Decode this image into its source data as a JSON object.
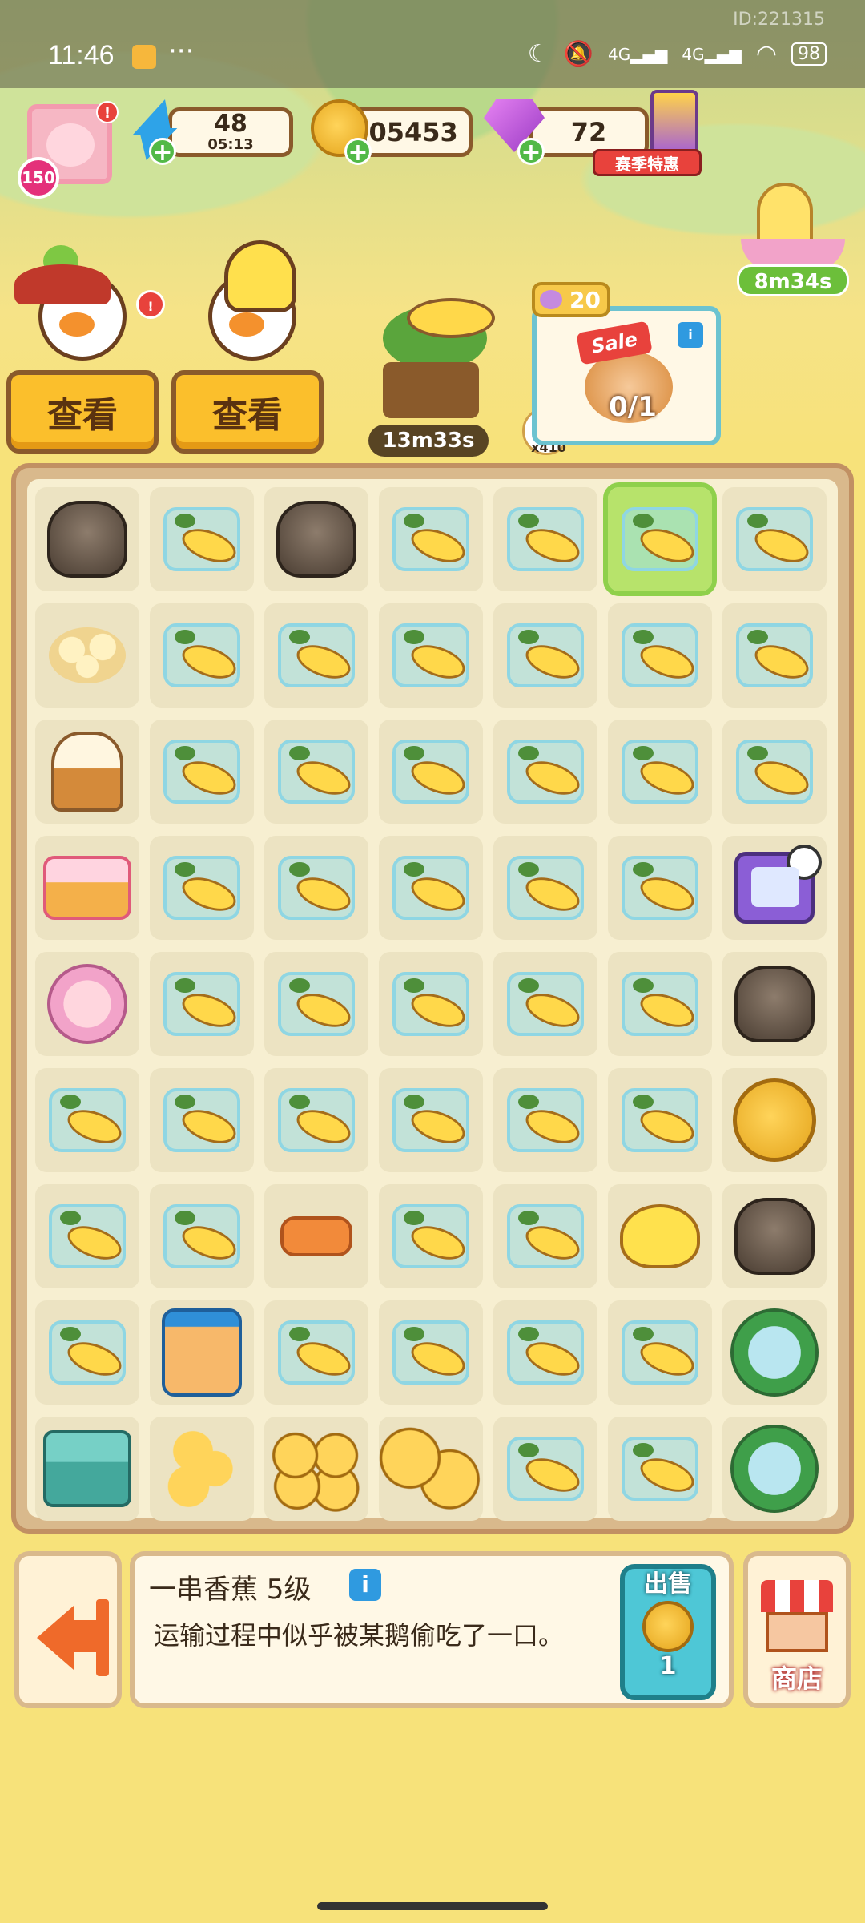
{
  "status_bar": {
    "time": "11:46",
    "more": "···",
    "id_text": "ID:221315",
    "network1": "4G",
    "network2": "4G",
    "battery": "98"
  },
  "player": {
    "level": "150",
    "alert": "!"
  },
  "resources": {
    "energy": "48",
    "energy_timer": "05:13",
    "coins": "205453",
    "gems": "72",
    "season_pack_label": "赛季特惠"
  },
  "event": {
    "timer": "8m34s"
  },
  "characters": {
    "alert": "!",
    "view_left_label": "查看",
    "view_right_label": "查看"
  },
  "tree": {
    "timer": "13m33s",
    "coin_bonus": "x410"
  },
  "sale": {
    "count": "20",
    "tag": "Sale",
    "info": "i",
    "progress": "0/1"
  },
  "board": {
    "rows": [
      [
        "web-stump",
        "banana-boxed",
        "web-stump",
        "banana-boxed",
        "banana-boxed",
        "banana-boxed-selected",
        "banana-boxed"
      ],
      [
        "banana-slices",
        "banana-boxed",
        "banana-boxed",
        "banana-boxed",
        "banana-boxed",
        "banana-boxed",
        "banana-boxed"
      ],
      [
        "banana-cake",
        "banana-boxed",
        "banana-boxed",
        "banana-boxed",
        "banana-boxed",
        "banana-boxed",
        "banana-boxed"
      ],
      [
        "banana-bento-box",
        "banana-boxed",
        "banana-boxed",
        "banana-boxed",
        "banana-boxed",
        "banana-boxed",
        "tv-machine"
      ],
      [
        "dessert-plate",
        "banana-boxed",
        "banana-boxed",
        "banana-boxed",
        "banana-boxed",
        "banana-boxed",
        "web-stump"
      ],
      [
        "banana-boxed",
        "banana-boxed",
        "banana-boxed",
        "banana-boxed",
        "banana-boxed",
        "banana-boxed",
        "gold-coin"
      ],
      [
        "banana-boxed",
        "banana-boxed",
        "carrot",
        "banana-boxed",
        "banana-boxed",
        "banana-bunch",
        "web-stump"
      ],
      [
        "banana-boxed",
        "fish-jar",
        "banana-boxed",
        "banana-boxed",
        "banana-boxed",
        "banana-boxed",
        "palm-globe"
      ],
      [
        "ice-machine",
        "coin-stack",
        "coin-pile",
        "coin-pair",
        "banana-boxed",
        "banana-boxed",
        "palm-globe"
      ]
    ]
  },
  "detail": {
    "title": "一串香蕉 5级",
    "info": "i",
    "description": "运输过程中似乎被某鹅偷吃了一口。",
    "sell_label": "出售",
    "sell_price": "1",
    "shop_label": "商店"
  },
  "colors": {
    "background": "#f7e27a",
    "board": "#f7efd1",
    "accent": "#4ec7d6",
    "button": "#fbbf2c"
  }
}
